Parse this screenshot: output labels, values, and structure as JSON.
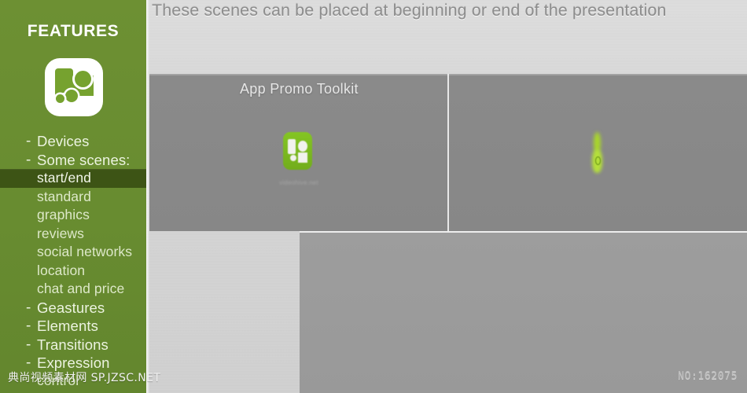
{
  "headline": "These scenes can be placed at beginning or end of the presentation",
  "sidebar": {
    "title": "FEATURES",
    "icon_name": "app-devices-gears-icon",
    "accent_color": "#6b8e32",
    "highlight_color": "#3d5415",
    "items": [
      {
        "bullet": "-",
        "label": "Devices",
        "type": "top",
        "highlighted": false
      },
      {
        "bullet": "-",
        "label": "Some scenes:",
        "type": "top",
        "highlighted": false
      },
      {
        "bullet": "",
        "label": "start/end",
        "type": "sub",
        "highlighted": true
      },
      {
        "bullet": "",
        "label": "standard",
        "type": "sub",
        "highlighted": false
      },
      {
        "bullet": "",
        "label": "graphics",
        "type": "sub",
        "highlighted": false
      },
      {
        "bullet": "",
        "label": "reviews",
        "type": "sub",
        "highlighted": false
      },
      {
        "bullet": "",
        "label": "social networks",
        "type": "sub",
        "highlighted": false
      },
      {
        "bullet": "",
        "label": "location",
        "type": "sub",
        "highlighted": false
      },
      {
        "bullet": "",
        "label": "chat and price",
        "type": "sub",
        "highlighted": false
      },
      {
        "bullet": "-",
        "label": "Geastures",
        "type": "top",
        "highlighted": false
      },
      {
        "bullet": "-",
        "label": "Elements",
        "type": "top",
        "highlighted": false
      },
      {
        "bullet": "-",
        "label": "Transitions",
        "type": "top",
        "highlighted": false
      },
      {
        "bullet": "-",
        "label": "Expression",
        "type": "top",
        "highlighted": false
      },
      {
        "bullet": "",
        "label": "control",
        "type": "cont",
        "highlighted": false
      }
    ]
  },
  "preview": {
    "top_panel_color": "#888888",
    "bottom_panel_color": "#9b9b9b",
    "background_color": "#d7d7d7",
    "promo_title": "App Promo Toolkit",
    "promo_icon_name": "app-promo-toolkit-icon",
    "promo_subtitle": "videohive.net",
    "glow_icon_name": "green-glow-shape"
  },
  "watermarks": {
    "left": "典尚视频素材网 SP.JZSC.NET",
    "right": "NO:162075"
  }
}
